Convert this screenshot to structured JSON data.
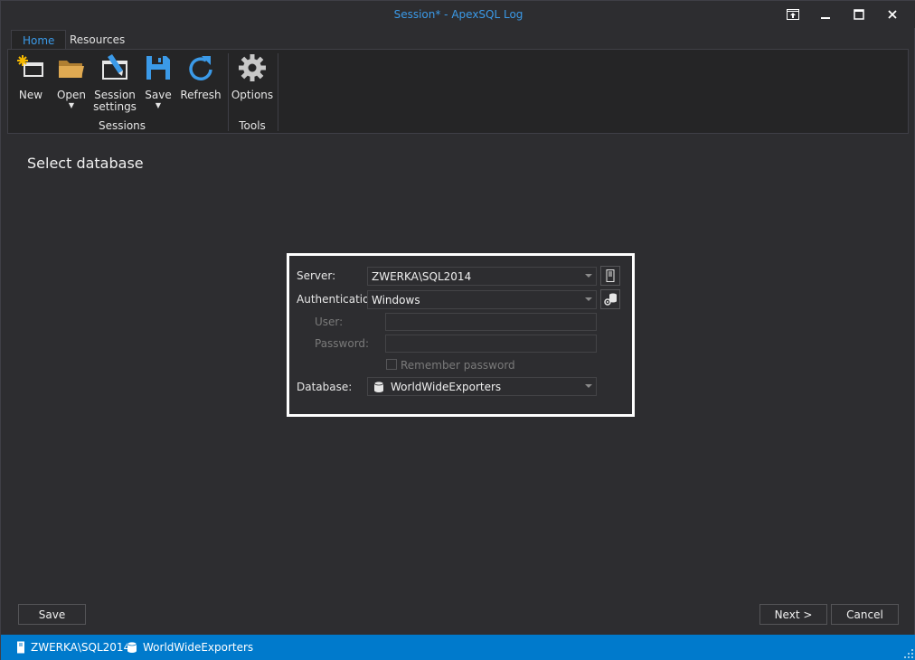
{
  "window": {
    "title": "Session* - ApexSQL Log",
    "controls": [
      "restore-to-tray",
      "minimize",
      "maximize",
      "close"
    ]
  },
  "ribbon": {
    "tabs": [
      {
        "label": "Home",
        "active": true
      },
      {
        "label": "Resources",
        "active": false
      }
    ],
    "buttons": {
      "new": {
        "label": "New",
        "icon": "new-session-icon"
      },
      "open": {
        "label": "Open",
        "icon": "folder-icon"
      },
      "session_settings": {
        "label_line1": "Session",
        "label_line2": "settings",
        "icon": "session-settings-icon"
      },
      "save": {
        "label": "Save",
        "icon": "floppy-icon"
      },
      "refresh": {
        "label": "Refresh",
        "icon": "refresh-icon"
      },
      "options": {
        "label": "Options",
        "icon": "gear-icon"
      }
    },
    "groups": {
      "sessions": "Sessions",
      "tools": "Tools"
    }
  },
  "page": {
    "title": "Select database"
  },
  "connection": {
    "server_label": "Server:",
    "server_value": "ZWERKA\\SQL2014",
    "auth_label": "Authentication:",
    "auth_value": "Windows",
    "user_label": "User:",
    "user_value": "",
    "password_label": "Password:",
    "password_value": "",
    "remember_label": "Remember password",
    "remember_checked": false,
    "database_label": "Database:",
    "database_value": "WorldWideExporters"
  },
  "footer": {
    "save_label": "Save",
    "next_label": "Next >",
    "cancel_label": "Cancel"
  },
  "statusbar": {
    "server": "ZWERKA\\SQL2014",
    "database": "WorldWideExporters"
  },
  "colors": {
    "accent": "#007acc",
    "title_text": "#3b9ae8",
    "background": "#2d2d30",
    "ribbon_background": "#252526",
    "panel_border": "#ffffff",
    "new_star": "#f5b800",
    "folder": "#d8a04a",
    "blue_icon": "#3b9ae8",
    "gear": "#c8c8c8"
  }
}
